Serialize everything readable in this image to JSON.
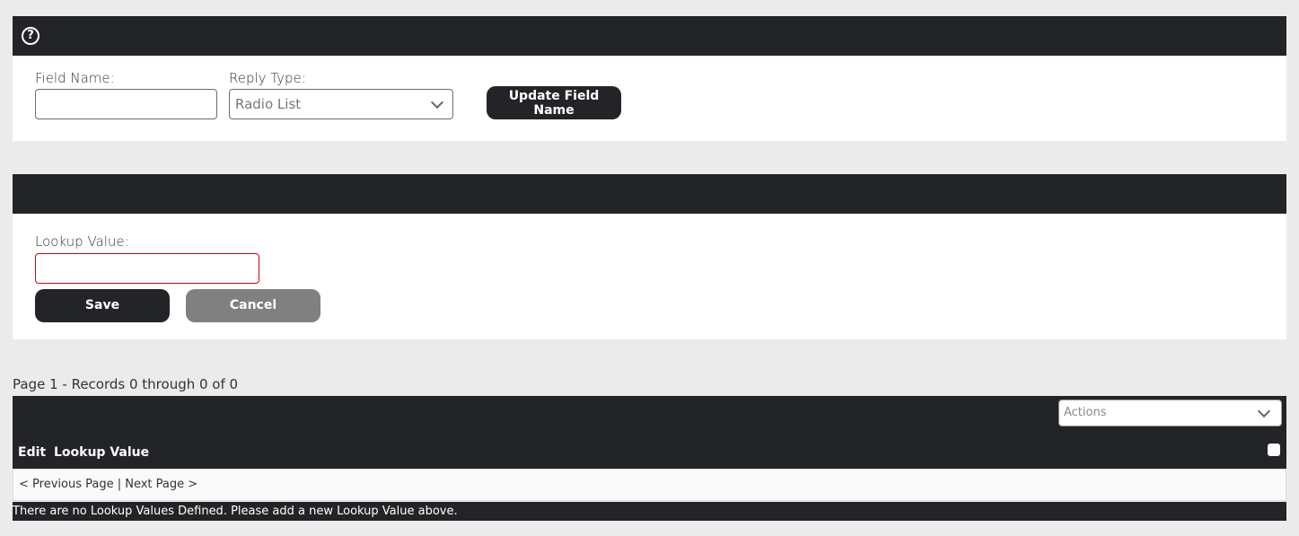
{
  "field_panel": {
    "field_name_label": "Field Name:",
    "field_name_value": "",
    "reply_type_label": "Reply Type:",
    "reply_type_value": "Radio List",
    "update_button": "Update Field Name"
  },
  "lookup_panel": {
    "lookup_value_label": "Lookup Value:",
    "lookup_value": "",
    "save_button": "Save",
    "cancel_button": "Cancel"
  },
  "grid": {
    "page_info": "Page 1 - Records 0 through 0 of 0",
    "actions_placeholder": "Actions",
    "columns": [
      "Edit",
      "Lookup Value"
    ],
    "pager": {
      "previous": "< Previous Page",
      "separator": " | ",
      "next": "Next Page >"
    },
    "empty_message": "There are no Lookup Values Defined. Please add a new Lookup Value above."
  },
  "colors": {
    "header_dark": "#222427",
    "invalid_border": "#d0021b",
    "cancel_grey": "#808080"
  },
  "icons": {
    "help": "question-circle-icon",
    "dropdown": "chevron-down-icon"
  }
}
